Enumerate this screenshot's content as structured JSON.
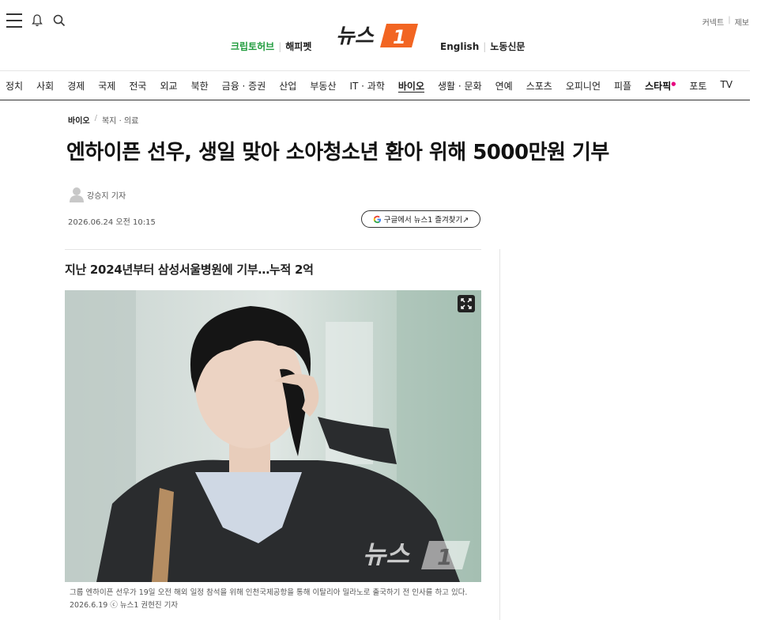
{
  "header": {
    "logo_text": "뉴스1",
    "logo_number": "1",
    "util_links": [
      "커넥트",
      "제보"
    ],
    "left_links": [
      {
        "label": "크립토허브",
        "color": "#1f9b3c"
      },
      {
        "label": "해피펫",
        "color": "#222222"
      }
    ],
    "right_links": [
      "English",
      "노동신문"
    ],
    "icons": [
      "menu-icon",
      "bell-icon",
      "search-icon"
    ]
  },
  "nav": {
    "items": [
      {
        "label": "정치"
      },
      {
        "label": "사회"
      },
      {
        "label": "경제"
      },
      {
        "label": "국제"
      },
      {
        "label": "전국"
      },
      {
        "label": "외교"
      },
      {
        "label": "북한"
      },
      {
        "label": "금융 · 증권"
      },
      {
        "label": "산업"
      },
      {
        "label": "부동산"
      },
      {
        "label": "IT · 과학"
      },
      {
        "label": "바이오",
        "active": true
      },
      {
        "label": "생활 · 문화"
      },
      {
        "label": "연예"
      },
      {
        "label": "스포츠"
      },
      {
        "label": "오피니언"
      },
      {
        "label": "피플"
      },
      {
        "label": "스타픽"
      },
      {
        "label": "포토"
      },
      {
        "label": "TV"
      }
    ]
  },
  "article": {
    "breadcrumb": {
      "section": "바이오",
      "sub": "복지 · 의료"
    },
    "headline": "엔하이픈 선우, 생일 맞아 소아청소년 환아 위해 5000만원 기부",
    "author": "강승지 기자",
    "date": "2026.06.24 오전 10:15",
    "google_button": "구글에서 뉴스1 즐겨찾기↗",
    "subtitle": "지난 2024년부터 삼성서울병원에 기부…누적 2억",
    "caption": "그룹 엔하이픈 선우가 19일 오전 해외 일정 참석을 위해 인천국제공항을 통해 이탈리아 밀라노로 출국하기 전 인사를 하고 있다. 2026.6.19 ⓒ 뉴스1 권현진 기자",
    "photo_watermark": "뉴스1"
  },
  "colors": {
    "brand_orange": "#f26522",
    "green_link": "#1f9b3c",
    "pink_accent": "#e6007e"
  }
}
